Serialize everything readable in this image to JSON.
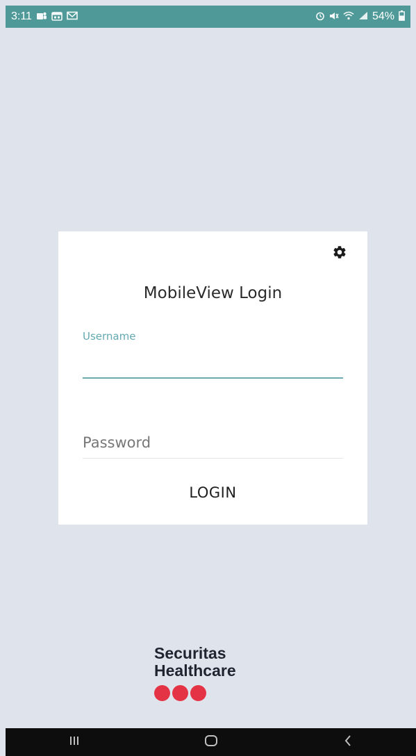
{
  "status_bar": {
    "time": "3:11",
    "battery": "54%",
    "left_icons": [
      "teams-icon",
      "calendar-icon",
      "gmail-icon"
    ],
    "right_icons": [
      "alarm-icon",
      "mute-icon",
      "wifi-icon",
      "signal-icon",
      "battery-icon"
    ]
  },
  "login": {
    "settings_icon": "gear-icon",
    "title": "MobileView Login",
    "username_label": "Username",
    "username_value": "",
    "password_placeholder": "Password",
    "password_value": "",
    "login_label": "LOGIN"
  },
  "brand": {
    "line1": "Securitas",
    "line2": "Healthcare",
    "dot_color": "#e53346"
  },
  "nav_bar": {
    "buttons": [
      "recents-icon",
      "home-icon",
      "back-icon"
    ]
  },
  "colors": {
    "status_bar": "#4f9a99",
    "background": "#dfe4ec",
    "accent": "#63a9b2"
  }
}
